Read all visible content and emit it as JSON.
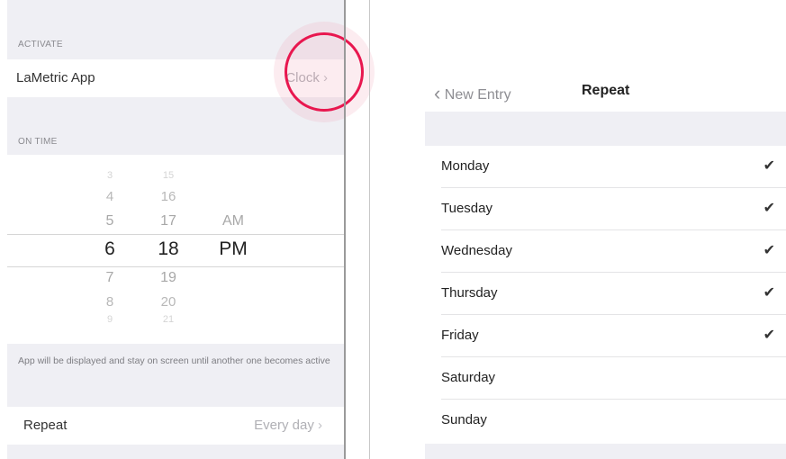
{
  "left": {
    "activate_header": "ACTIVATE",
    "app_row": {
      "label": "LaMetric App",
      "value": "Clock",
      "chevron": "›"
    },
    "on_time_header": "ON TIME",
    "picker": {
      "hours": [
        "3",
        "4",
        "5",
        "6",
        "7",
        "8",
        "9"
      ],
      "minutes": [
        "15",
        "16",
        "17",
        "18",
        "19",
        "20",
        "21"
      ],
      "ampm": [
        "AM",
        "PM"
      ],
      "selected_hour": "6",
      "selected_minute": "18",
      "selected_ampm": "PM"
    },
    "footnote": "App will be displayed and stay on screen until another one becomes active",
    "repeat_row": {
      "label": "Repeat",
      "value": "Every day",
      "chevron": "›"
    }
  },
  "right": {
    "back_chevron": "‹",
    "back_label": "New Entry",
    "title": "Repeat",
    "check_glyph": "✔",
    "days": [
      {
        "label": "Monday",
        "checked": true
      },
      {
        "label": "Tuesday",
        "checked": true
      },
      {
        "label": "Wednesday",
        "checked": true
      },
      {
        "label": "Thursday",
        "checked": true
      },
      {
        "label": "Friday",
        "checked": true
      },
      {
        "label": "Saturday",
        "checked": false
      },
      {
        "label": "Sunday",
        "checked": false
      }
    ]
  },
  "colors": {
    "highlight": "#e8174f",
    "grouped_background": "#efeff4",
    "secondary_text": "#8e8e93"
  }
}
